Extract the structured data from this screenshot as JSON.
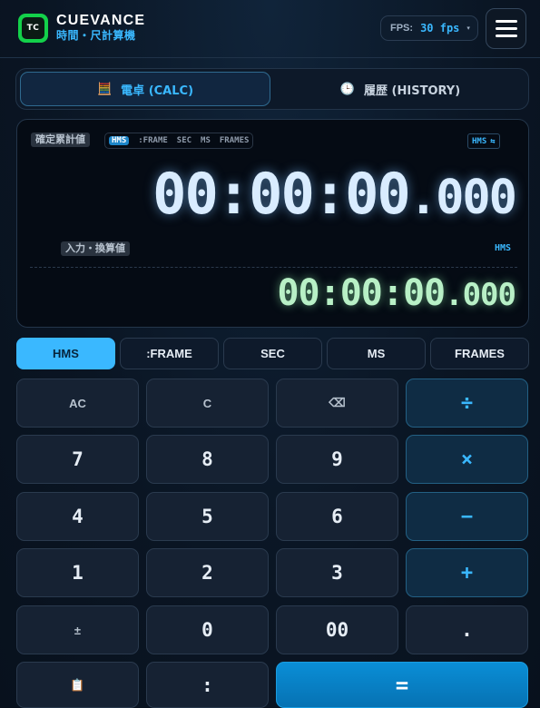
{
  "header": {
    "logo_text": "TC",
    "brand_name": "CUEVANCE",
    "brand_subtitle": "時間・尺計算機",
    "fps_label": "FPS:",
    "fps_value": "30 fps",
    "fps_caret": "▾",
    "menu_icon": "hamburger-menu-icon"
  },
  "tabs": [
    {
      "label": "電卓 (CALC)",
      "icon": "calculator-icon",
      "glyph": "🧮",
      "active": true
    },
    {
      "label": "履歴 (HISTORY)",
      "icon": "clock-icon",
      "glyph": "🕒",
      "active": false
    }
  ],
  "display": {
    "accumulated_label": "確定累計値",
    "mode_strip": [
      "HMS",
      ":FRAME",
      "SEC",
      "MS",
      "FRAMES"
    ],
    "mode_strip_active": "HMS",
    "format_tag": "HMS",
    "format_tag_icon": "swap-icon",
    "format_tag_glyph": "⇆",
    "main_time": "00:00:00",
    "main_ms": ".000",
    "input_label": "入力・換算値",
    "input_format": "HMS",
    "sub_time": "00:00:00",
    "sub_ms": ".000"
  },
  "modes": [
    "HMS",
    ":FRAME",
    "SEC",
    "MS",
    "FRAMES"
  ],
  "active_mode": "HMS",
  "keypad": {
    "ac": "AC",
    "c": "C",
    "backspace": "⌫",
    "divide": "÷",
    "multiply": "×",
    "minus": "−",
    "plus": "+",
    "seven": "7",
    "eight": "8",
    "nine": "9",
    "four": "4",
    "five": "5",
    "six": "6",
    "one": "1",
    "two": "2",
    "three": "3",
    "plus_minus": "±",
    "zero": "0",
    "double_zero": "00",
    "dot": ".",
    "paste": "📋",
    "colon": ":",
    "equals": "="
  },
  "colors": {
    "accent": "#3ab8ff",
    "logo_green": "#13d14a",
    "sub_time_green": "#b8f0c6",
    "equals_blue": "#0a8ed6"
  }
}
